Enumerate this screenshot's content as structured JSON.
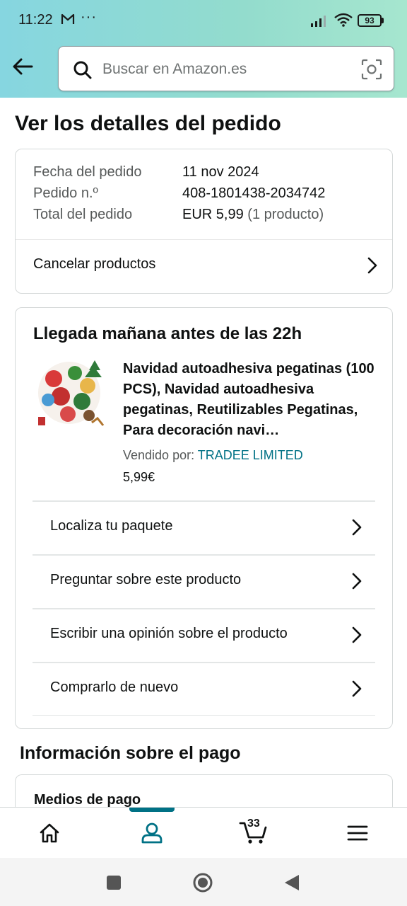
{
  "status_bar": {
    "time": "11:22",
    "more": "···",
    "battery": "93"
  },
  "header": {
    "search_placeholder": "Buscar en Amazon.es",
    "colors": {
      "gradient_start": "#86d6e0",
      "gradient_end": "#a6e6cf"
    }
  },
  "page": {
    "title": "Ver los detalles del pedido"
  },
  "order_summary": {
    "rows": [
      {
        "label": "Fecha del pedido",
        "value": "11 nov 2024"
      },
      {
        "label": "Pedido n.º",
        "value": "408-1801438-2034742"
      },
      {
        "label": "Total del pedido",
        "value": "EUR 5,99",
        "extra": "(1 producto)"
      }
    ],
    "cancel_label": "Cancelar productos"
  },
  "shipment": {
    "title": "Llegada mañana antes de las 22h",
    "product": {
      "title": "Navidad autoadhesiva pegatinas (100 PCS), Navidad autoadhesiva pegatinas, Reutilizables Pegatinas, Para decoración navi…",
      "seller_prefix": "Vendido por:",
      "seller_name": "TRADEE LIMITED",
      "price": "5,99€"
    },
    "actions": [
      {
        "label": "Localiza tu paquete"
      },
      {
        "label": "Preguntar sobre este producto"
      },
      {
        "label": "Escribir una opinión sobre el producto"
      },
      {
        "label": "Comprarlo de nuevo"
      }
    ]
  },
  "payment": {
    "title": "Información sobre el pago",
    "methods_label": "Medios de pago"
  },
  "bottom_nav": {
    "items": [
      {
        "icon": "home-icon"
      },
      {
        "icon": "account-icon",
        "active": true
      },
      {
        "icon": "cart-icon"
      },
      {
        "icon": "menu-icon"
      }
    ],
    "cart_count": "33",
    "accent": "#007185"
  },
  "android_nav": {
    "buttons": [
      "recents-icon",
      "home-circle-icon",
      "back-triangle-icon"
    ]
  }
}
